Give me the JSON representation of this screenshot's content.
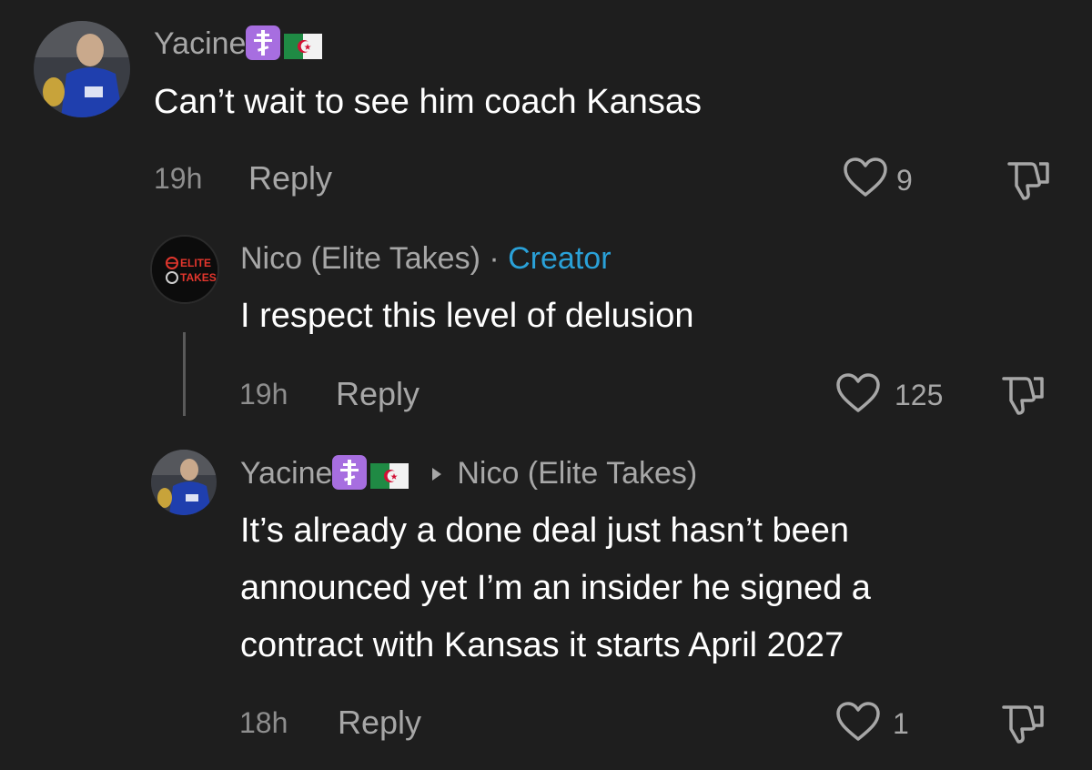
{
  "colors": {
    "background": "#1e1e1e",
    "username": "#a7a7a7",
    "text": "#ffffff",
    "meta": "#8e8e8e",
    "creator": "#2aa1d8"
  },
  "comments": [
    {
      "username": "Yacine",
      "badges": [
        "orthodox-cross-emoji",
        "algeria-flag-emoji"
      ],
      "text": "Can’t wait to see him coach Kansas",
      "time": "19h",
      "reply_label": "Reply",
      "likes": "9"
    },
    {
      "username": "Nico (Elite Takes)",
      "separator": "·",
      "role": "Creator",
      "avatar_text": [
        "ELITE",
        "TAKES"
      ],
      "text": "I respect this level of delusion",
      "time": "19h",
      "reply_label": "Reply",
      "likes": "125"
    },
    {
      "username": "Yacine",
      "badges": [
        "orthodox-cross-emoji",
        "algeria-flag-emoji"
      ],
      "reply_to": "Nico (Elite Takes)",
      "text_lines": [
        "It’s already a done deal just hasn’t been",
        "announced yet I’m an insider he signed a",
        "contract with Kansas it starts April 2027"
      ],
      "time": "18h",
      "reply_label": "Reply",
      "likes": "1"
    }
  ]
}
